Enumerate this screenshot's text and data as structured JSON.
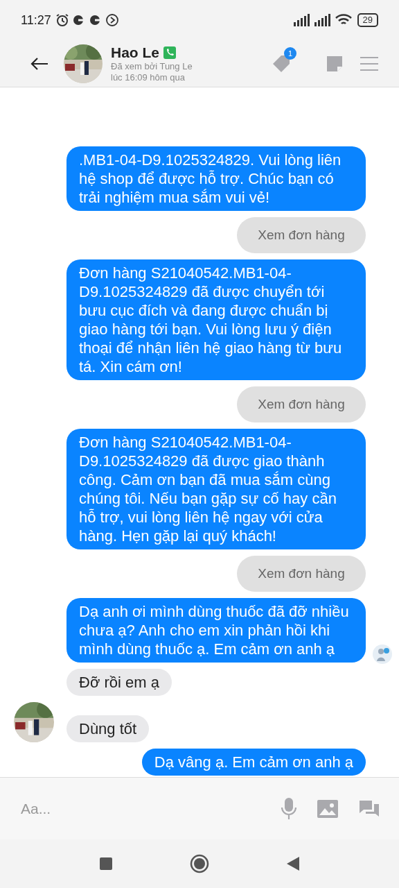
{
  "status_bar": {
    "time": "11:27",
    "battery": "29"
  },
  "header": {
    "name": "Hao Le",
    "seen_line_1": "Đã xem bởi Tung Le",
    "seen_line_2": "lúc 16:09 hôm qua",
    "badge": "1"
  },
  "messages": [
    {
      "kind": "sent",
      "text": ".MB1-04-D9.1025324829. Vui lòng liên hệ shop để được hỗ trợ. Chúc bạn có trải nghiệm mua sắm vui vẻ!"
    },
    {
      "kind": "button",
      "text": "Xem đơn hàng"
    },
    {
      "kind": "sent",
      "text": "Đơn hàng S21040542.MB1-04-D9.1025324829 đã được chuyển tới bưu cục đích và đang được chuẩn bị giao hàng tới bạn. Vui lòng lưu ý điện thoại để nhận liên hệ giao hàng từ bưu tá. Xin cám ơn!"
    },
    {
      "kind": "button",
      "text": "Xem đơn hàng"
    },
    {
      "kind": "sent",
      "text": "Đơn hàng S21040542.MB1-04-D9.1025324829 đã được giao thành công. Cảm ơn bạn đã mua sắm cùng chúng tôi. Nếu bạn gặp sự cố hay cần hỗ trợ, vui lòng liên hệ ngay với cửa hàng. Hẹn gặp lại quý khách!"
    },
    {
      "kind": "button",
      "text": "Xem đơn hàng"
    },
    {
      "kind": "sent",
      "text": "Dạ anh ơi mình dùng thuốc đã đỡ nhiều chưa ạ? Anh cho em xin phản hồi khi mình dùng thuốc ạ. Em cảm ơn anh ạ",
      "seen": true
    },
    {
      "kind": "received",
      "text": "Đỡ rồi em ạ",
      "avatar": false
    },
    {
      "kind": "received",
      "text": "Dùng tốt",
      "avatar": true
    },
    {
      "kind": "sent",
      "text": "Dạ vâng ạ. Em cảm ơn anh ạ"
    }
  ],
  "composer": {
    "placeholder": "Aa..."
  }
}
